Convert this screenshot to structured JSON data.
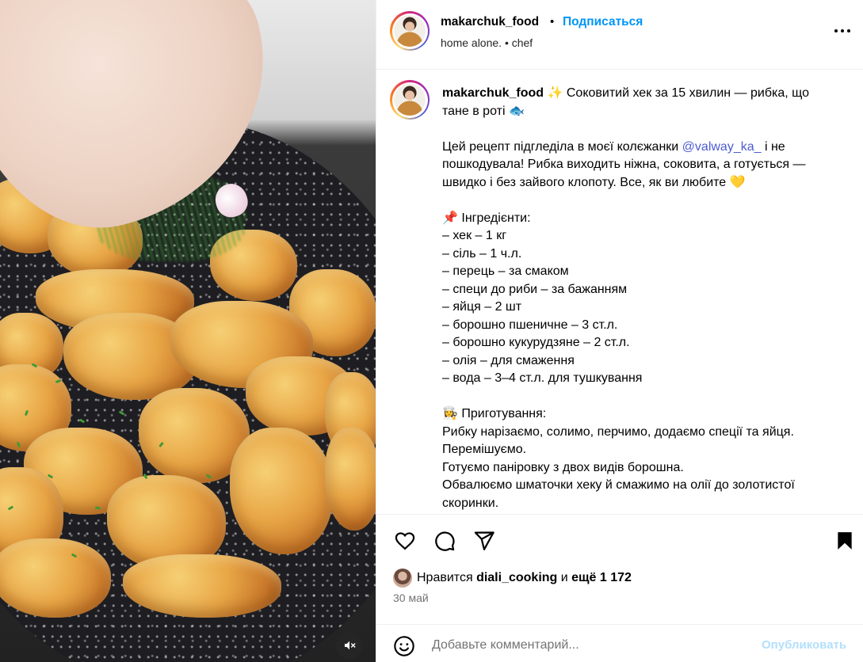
{
  "post": {
    "username": "makarchuk_food",
    "follow_label": "Подписаться",
    "subtitle": "home alone. • chef"
  },
  "caption": {
    "username": "makarchuk_food",
    "line1": " ✨ Соковитий хек за 15 хвилин — рибка, що тане в роті 🐟",
    "para2_a": "Цей рецепт підгледіла в моєї колєжанки ",
    "mention": "@valway_ka_",
    "para2_b": " і не пошкодувала! Рибка виходить ніжна, соковита, а готується — швидко і без зайвого клопоту. Все, як ви любите 💛",
    "ingredients_title": "📌 Інгредієнти:",
    "ingredients": [
      "– хек – 1 кг",
      "– сіль – 1 ч.л.",
      "– перець – за смаком",
      "– специ до риби – за бажанням",
      "– яйця – 2 шт",
      "– борошно пшеничне – 3 ст.л.",
      "– борошно кукурудзяне – 2 ст.л.",
      "– олія – для смаження",
      "– вода – 3–4 ст.л. для тушкування"
    ],
    "method_title": "👩‍🍳 Приготування:",
    "method": [
      "Рибку нарізаємо, солимо, перчимо, додаємо спеції та яйця. Перемішуємо.",
      "Готуємо паніровку з двох видів борошна.",
      "Обвалюємо шматочки хеку й смажимо на олії до золотистої скоринки."
    ]
  },
  "likes": {
    "prefix": "Нравится",
    "user": "diali_cooking",
    "middle": "и",
    "rest": "ещё 1 172"
  },
  "date": "30 май",
  "comment": {
    "placeholder": "Добавьте комментарий...",
    "post_label": "Опубликовать"
  },
  "icons": {
    "more": "more-options-icon",
    "like": "heart-icon",
    "comment": "comment-icon",
    "share": "share-icon",
    "save": "bookmark-icon",
    "emoji": "emoji-icon",
    "mute": "muted-speaker-icon"
  },
  "colors": {
    "link_blue": "#0095f6",
    "mention": "#4b5bd5",
    "muted_text": "#737373",
    "post_button_disabled": "#b2dffc"
  }
}
